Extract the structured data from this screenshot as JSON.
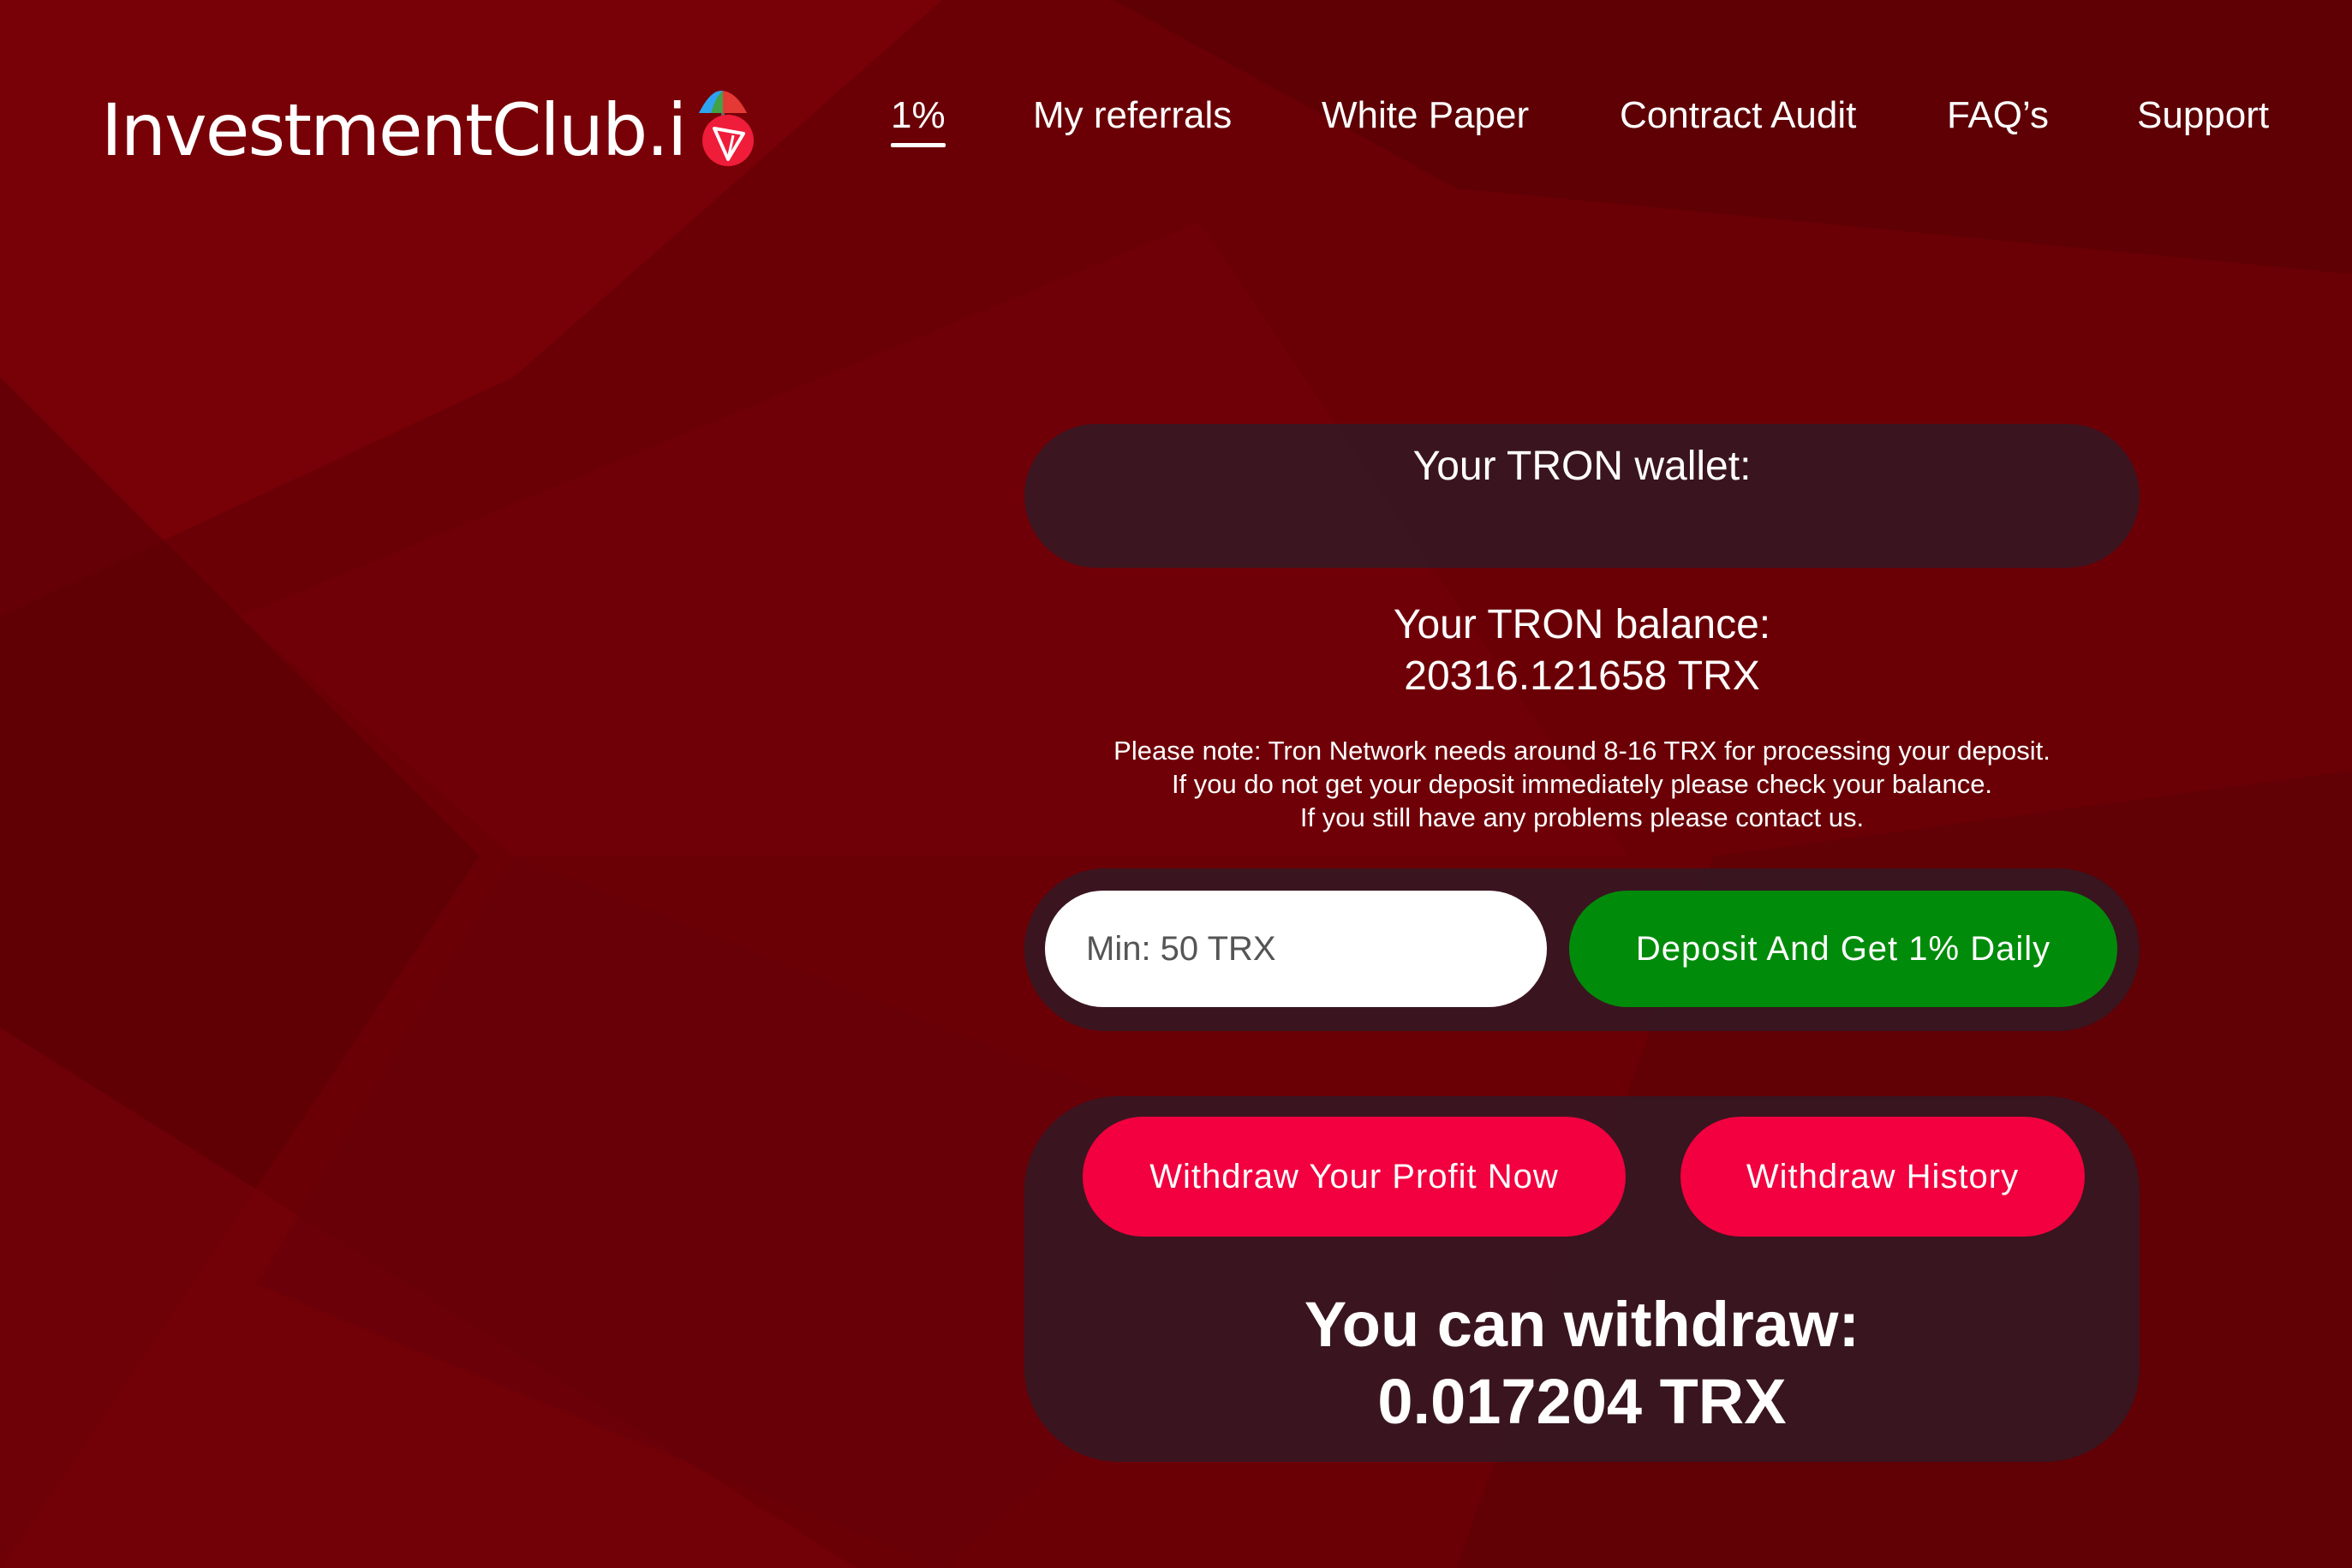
{
  "header": {
    "logo_text": "InvestmentClub.i",
    "nav": [
      {
        "label": "1%",
        "active": true
      },
      {
        "label": "My referrals",
        "active": false
      },
      {
        "label": "White Paper",
        "active": false
      },
      {
        "label": "Contract Audit",
        "active": false
      },
      {
        "label": "FAQ’s",
        "active": false
      },
      {
        "label": "Support",
        "active": false
      }
    ]
  },
  "wallet": {
    "label": "Your TRON wallet:",
    "address": ""
  },
  "balance": {
    "label": "Your TRON balance:",
    "value": "20316.121658 TRX"
  },
  "note": {
    "line1": "Please note: Tron Network needs around 8-16 TRX for processing your deposit.",
    "line2": "If you do not get your deposit immediately please check your balance.",
    "line3": "If you still have any problems please contact us."
  },
  "deposit": {
    "input_value": "",
    "input_placeholder": "Min: 50 TRX",
    "button_label": "Deposit And Get 1% Daily"
  },
  "withdraw": {
    "profit_button_label": "Withdraw Your Profit Now",
    "history_button_label": "Withdraw History",
    "available_label": "You can withdraw:",
    "available_value": "0.017204 TRX"
  },
  "colors": {
    "background": "#6a0006",
    "panel": "#301a26",
    "deposit_button": "#008c0a",
    "withdraw_button": "#f2003f",
    "text": "#ffffff"
  },
  "icons": {
    "logo_badge": "tron-logo-icon",
    "logo_umbrella": "umbrella-icon"
  }
}
